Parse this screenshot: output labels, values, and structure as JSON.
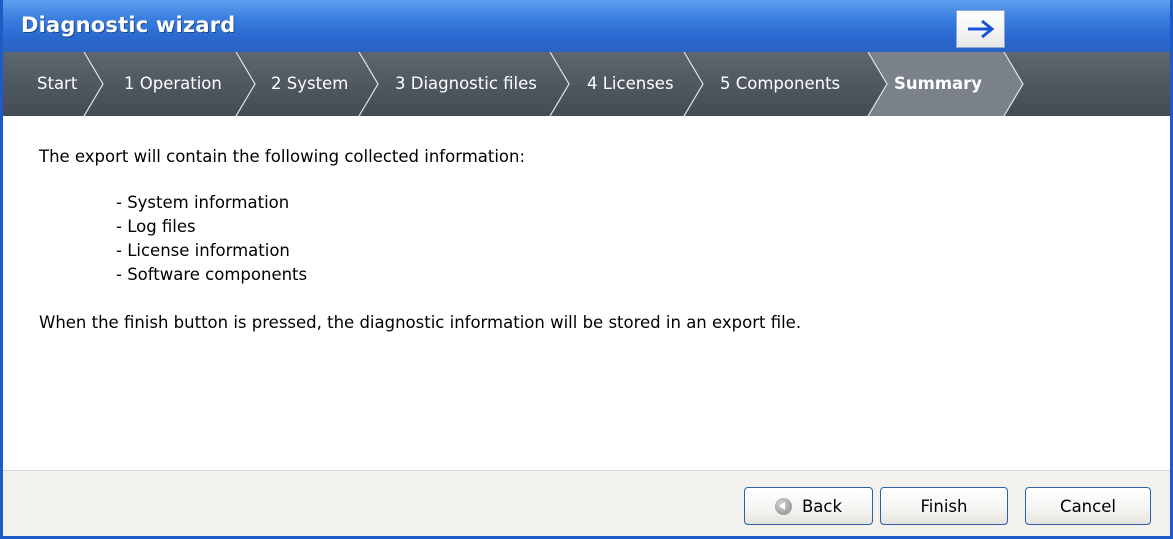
{
  "window": {
    "title": "Diagnostic wizard",
    "next_icon": "arrow-right-icon"
  },
  "steps": [
    {
      "label": "Start",
      "active": false
    },
    {
      "label": "1 Operation",
      "active": false
    },
    {
      "label": "2 System",
      "active": false
    },
    {
      "label": "3 Diagnostic files",
      "active": false
    },
    {
      "label": "4 Licenses",
      "active": false
    },
    {
      "label": "5 Components",
      "active": false
    },
    {
      "label": "Summary",
      "active": true
    }
  ],
  "content": {
    "intro": "The export will contain the following collected information:",
    "items": [
      "- System information",
      "- Log files",
      "- License information",
      "- Software components"
    ],
    "outro": "When the finish button is pressed, the diagnostic information will be stored in an export file."
  },
  "buttons": {
    "back": "Back",
    "finish": "Finish",
    "cancel": "Cancel"
  },
  "colors": {
    "titlebar": "#2a69cf",
    "crumbbar": "#4e565f",
    "active_step": "#7a8189",
    "footer": "#f4f2ef",
    "button_border": "#2f5fa8"
  }
}
